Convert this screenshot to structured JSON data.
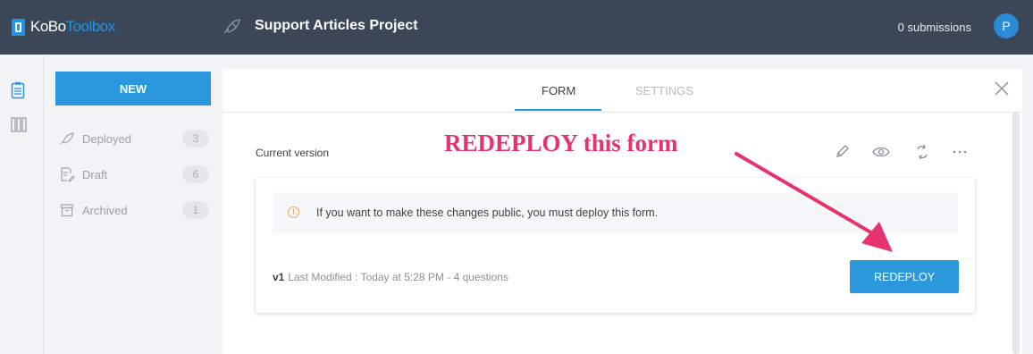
{
  "header": {
    "logo_kobo": "KoBo",
    "logo_toolbox": "Toolbox",
    "project_title": "Support Articles Project",
    "submissions": "0 submissions",
    "avatar_initial": "P"
  },
  "sidebar": {
    "new_label": "NEW",
    "items": [
      {
        "label": "Deployed",
        "count": "3",
        "icon": "rocket-icon"
      },
      {
        "label": "Draft",
        "count": "6",
        "icon": "draft-icon"
      },
      {
        "label": "Archived",
        "count": "1",
        "icon": "archive-icon"
      }
    ]
  },
  "tabs": {
    "form": "FORM",
    "settings": "SETTINGS"
  },
  "form": {
    "current_version_label": "Current version",
    "warning_text": "If you want to make these changes public, you must deploy this form.",
    "version": "v1",
    "last_modified": "Last Modified : Today at 5:28 PM - 4 questions",
    "redeploy_label": "REDEPLOY"
  },
  "annotation": {
    "text": "REDEPLOY this form",
    "color": "#e6336f"
  },
  "colors": {
    "topbar": "#3b4656",
    "accent": "#2b98dd",
    "warning": "#f0a656"
  }
}
